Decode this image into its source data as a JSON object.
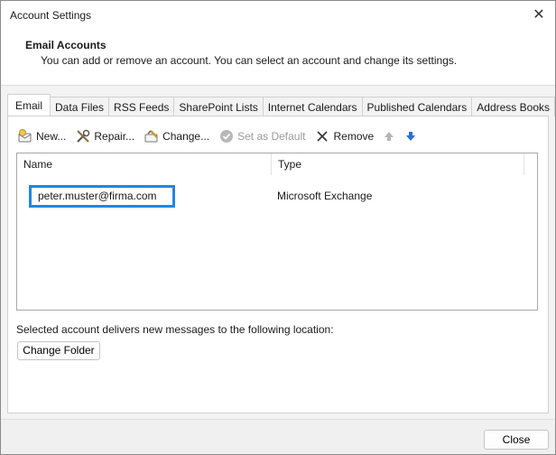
{
  "window": {
    "title": "Account Settings"
  },
  "header": {
    "title": "Email Accounts",
    "description": "You can add or remove an account. You can select an account and change its settings."
  },
  "tabs": [
    {
      "label": "Email",
      "active": true
    },
    {
      "label": "Data Files"
    },
    {
      "label": "RSS Feeds"
    },
    {
      "label": "SharePoint Lists"
    },
    {
      "label": "Internet Calendars"
    },
    {
      "label": "Published Calendars"
    },
    {
      "label": "Address Books"
    }
  ],
  "toolbar": {
    "new_label": "New...",
    "repair_label": "Repair...",
    "change_label": "Change...",
    "set_default_label": "Set as Default",
    "remove_label": "Remove",
    "icons": [
      "new-account-icon",
      "repair-icon",
      "change-icon",
      "set-default-check-icon",
      "remove-x-icon",
      "move-up-icon",
      "move-down-icon"
    ]
  },
  "list": {
    "columns": [
      "Name",
      "Type"
    ],
    "rows": [
      {
        "name": "peter.muster@firma.com",
        "type": "Microsoft Exchange",
        "highlighted": true
      }
    ]
  },
  "deliver_text": "Selected account delivers new messages to the following location:",
  "change_folder_label": "Change Folder",
  "close_label": "Close",
  "colors": {
    "highlight_border": "#1e88e5",
    "disabled_text": "#9a9a9a",
    "window_bg": "#f3f3f3"
  }
}
